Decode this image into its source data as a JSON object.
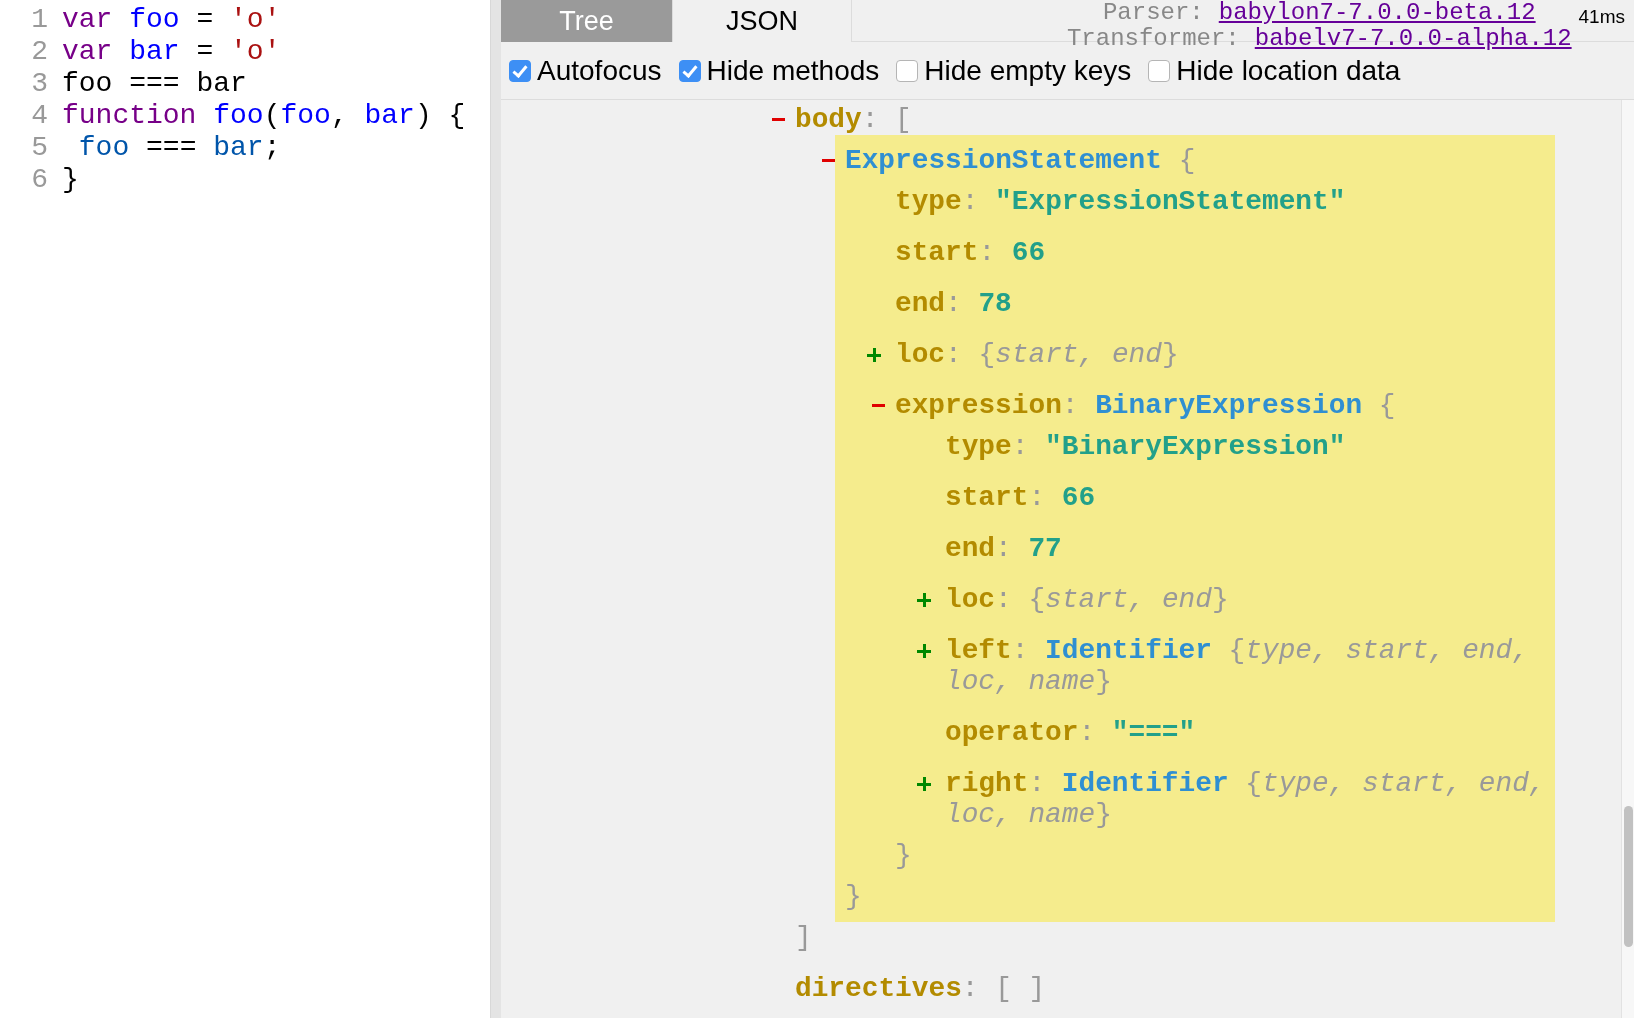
{
  "editor": {
    "lines": [
      {
        "number": "1",
        "tokens": [
          {
            "text": "var ",
            "kind": "keyword"
          },
          {
            "text": "foo",
            "kind": "def"
          },
          {
            "text": " = ",
            "kind": "plain"
          },
          {
            "text": "'o'",
            "kind": "string"
          }
        ]
      },
      {
        "number": "2",
        "tokens": [
          {
            "text": "var ",
            "kind": "keyword"
          },
          {
            "text": "bar",
            "kind": "def"
          },
          {
            "text": " = ",
            "kind": "plain"
          },
          {
            "text": "'o'",
            "kind": "string"
          }
        ]
      },
      {
        "number": "3",
        "tokens": [
          {
            "text": "foo === bar",
            "kind": "plain"
          }
        ]
      },
      {
        "number": "4",
        "tokens": [
          {
            "text": "function ",
            "kind": "keyword"
          },
          {
            "text": "foo",
            "kind": "def"
          },
          {
            "text": "(",
            "kind": "plain"
          },
          {
            "text": "foo",
            "kind": "def"
          },
          {
            "text": ", ",
            "kind": "plain"
          },
          {
            "text": "bar",
            "kind": "def"
          },
          {
            "text": ") {",
            "kind": "plain"
          }
        ]
      },
      {
        "number": "5",
        "tokens": [
          {
            "text": " foo",
            "kind": "variable"
          },
          {
            "text": " === ",
            "kind": "plain"
          },
          {
            "text": "bar",
            "kind": "variable"
          },
          {
            "text": ";",
            "kind": "plain"
          }
        ]
      },
      {
        "number": "6",
        "tokens": [
          {
            "text": "}",
            "kind": "plain"
          }
        ]
      }
    ]
  },
  "tabs": [
    {
      "label": "Tree",
      "selected": true
    },
    {
      "label": "JSON",
      "selected": false
    }
  ],
  "versions": [
    {
      "label": "Parser:",
      "link": "babylon7-7.0.0-beta.12"
    },
    {
      "label": "Transformer:",
      "link": "babelv7-7.0.0-alpha.12"
    }
  ],
  "timing": "41ms",
  "options": [
    {
      "label": "Autofocus",
      "checked": true
    },
    {
      "label": "Hide methods",
      "checked": true
    },
    {
      "label": "Hide empty keys",
      "checked": false
    },
    {
      "label": "Hide location data",
      "checked": false
    }
  ],
  "tree": [
    {
      "kind": "node",
      "key": "body",
      "sep": ":",
      "open": "[",
      "close": "]",
      "expanded": true,
      "highlighted": false,
      "children": [
        {
          "kind": "node",
          "type_name": "ExpressionStatement",
          "open": "{",
          "close": "}",
          "expanded": true,
          "highlighted": true,
          "children": [
            {
              "kind": "string",
              "key": "type",
              "sep": ":",
              "value": "\"ExpressionStatement\""
            },
            {
              "kind": "number",
              "key": "start",
              "sep": ":",
              "value": "66"
            },
            {
              "kind": "number",
              "key": "end",
              "sep": ":",
              "value": "78"
            },
            {
              "kind": "node",
              "key": "loc",
              "sep": ":",
              "open": "{",
              "summary": "start, end",
              "close": "}",
              "expanded": false,
              "highlighted": false
            },
            {
              "kind": "node",
              "key": "expression",
              "sep": ":",
              "type_name": "BinaryExpression",
              "open": "{",
              "close": "}",
              "expanded": true,
              "highlighted": false,
              "children": [
                {
                  "kind": "string",
                  "key": "type",
                  "sep": ":",
                  "value": "\"BinaryExpression\""
                },
                {
                  "kind": "number",
                  "key": "start",
                  "sep": ":",
                  "value": "66"
                },
                {
                  "kind": "number",
                  "key": "end",
                  "sep": ":",
                  "value": "77"
                },
                {
                  "kind": "node",
                  "key": "loc",
                  "sep": ":",
                  "open": "{",
                  "summary": "start, end",
                  "close": "}",
                  "expanded": false,
                  "highlighted": false
                },
                {
                  "kind": "node",
                  "key": "left",
                  "sep": ":",
                  "type_name": "Identifier",
                  "open": "{",
                  "summary": "type, start, end, loc, name",
                  "close": "}",
                  "expanded": false,
                  "highlighted": false
                },
                {
                  "kind": "string",
                  "key": "operator",
                  "sep": ":",
                  "value": "\"===\""
                },
                {
                  "kind": "node",
                  "key": "right",
                  "sep": ":",
                  "type_name": "Identifier",
                  "open": "{",
                  "summary": "type, start, end, loc, name",
                  "close": "}",
                  "expanded": false,
                  "highlighted": false
                }
              ]
            }
          ]
        }
      ]
    },
    {
      "kind": "empty",
      "key": "directives",
      "sep": ":",
      "value": "[ ]"
    }
  ]
}
